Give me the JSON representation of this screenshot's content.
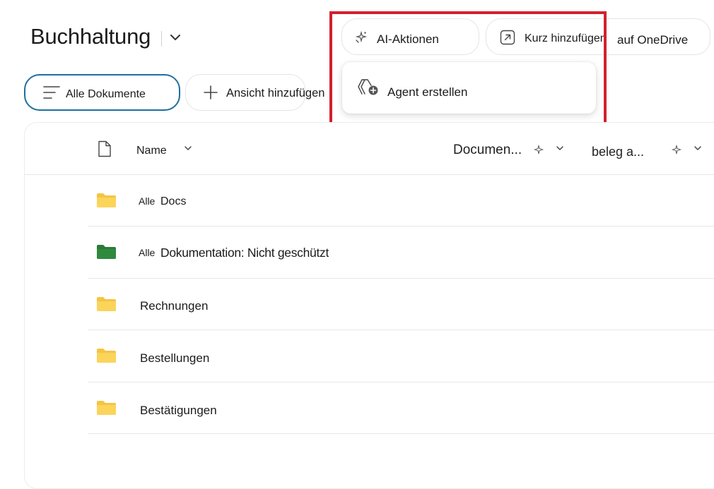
{
  "header": {
    "title": "Buchhaltung"
  },
  "toolbar": {
    "ai_actions_label": "AI-Aktionen",
    "shortcut_label": "Kurz hinzufügen",
    "onedrive_label": "auf OneDrive"
  },
  "ai_menu": {
    "create_agent_label": "Agent erstellen"
  },
  "views": {
    "all_documents_label": "Alle Dokumente",
    "add_view_label": "Ansicht hinzufügen"
  },
  "table": {
    "columns": {
      "name": "Name",
      "document": "Documen...",
      "beleg": "beleg a..."
    },
    "rows": [
      {
        "prefix": "Alle",
        "name": "Docs",
        "folder_color": "#f5c443"
      },
      {
        "prefix": "Alle",
        "name": "Dokumentation: Nicht geschützt",
        "folder_color": "#2f8a3e"
      },
      {
        "prefix": "",
        "name": "Rechnungen",
        "folder_color": "#f5c443"
      },
      {
        "prefix": "",
        "name": "Bestellungen",
        "folder_color": "#f5c443"
      },
      {
        "prefix": "",
        "name": "Bestätigungen",
        "folder_color": "#f5c443"
      }
    ]
  },
  "colors": {
    "accent": "#1f6f9f",
    "highlight_box": "#d2202f"
  }
}
